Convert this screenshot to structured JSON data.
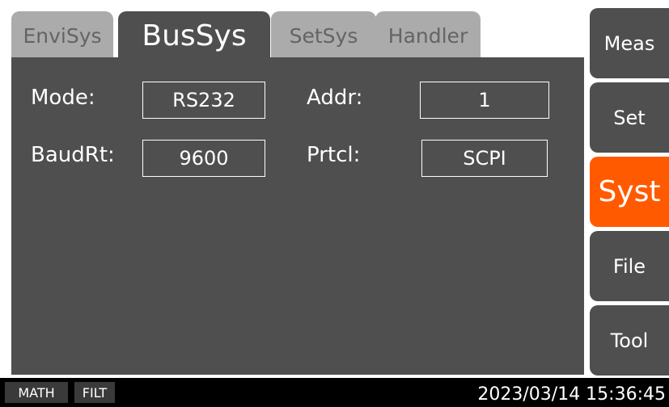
{
  "tabs": {
    "envisys": "EnviSys",
    "bussys": "BusSys",
    "setsys": "SetSys",
    "handler": "Handler"
  },
  "fields": {
    "mode_label": "Mode:",
    "mode_value": "RS232",
    "addr_label": "Addr:",
    "addr_value": "1",
    "baud_label": "BaudRt:",
    "baud_value": "9600",
    "prtcl_label": "Prtcl:",
    "prtcl_value": "SCPI"
  },
  "softkeys": {
    "meas": "Meas",
    "set": "Set",
    "syst": "Syst",
    "file": "File",
    "tool": "Tool"
  },
  "status": {
    "math": "MATH",
    "filt": "FILT",
    "datetime": "2023/03/14 15:36:45"
  },
  "colors": {
    "panel": "#4f4f4f",
    "inactive_tab": "#ababab",
    "active_softkey": "#ff5a00",
    "status_bar": "#000000"
  }
}
